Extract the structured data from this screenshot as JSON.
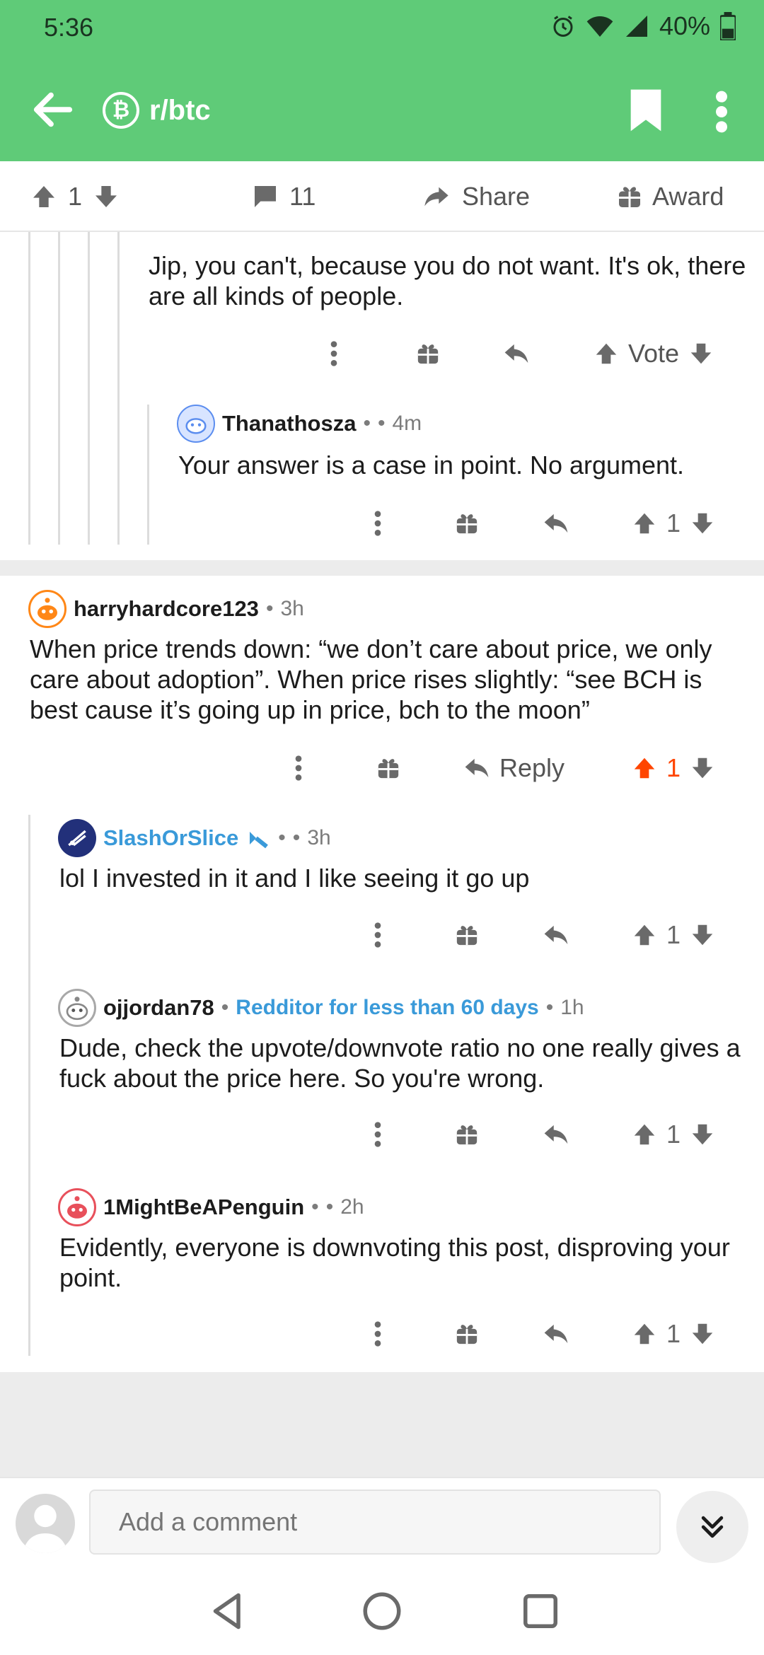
{
  "status_bar": {
    "time": "5:36",
    "battery": "40%"
  },
  "header": {
    "subreddit": "r/btc",
    "coin_symbol": "₿"
  },
  "post_bar": {
    "score": "1",
    "comments": "11",
    "share": "Share",
    "award": "Award"
  },
  "comments": [
    {
      "id": "c1",
      "text": "Jip, you can't, because you do not want. It's ok, there are all kinds of people.",
      "vote_label": "Vote"
    },
    {
      "id": "c2",
      "user": "Thanathosza",
      "time": "4m",
      "text": "Your answer is a case in point. No argument.",
      "score": "1"
    },
    {
      "id": "c3",
      "user": "harryhardcore123",
      "time": "3h",
      "text": "When price trends down: “we don’t care about price, we only care about adoption”. When price rises slightly: “see BCH is best cause it’s going up in price, bch to the moon”",
      "score": "1",
      "reply": "Reply"
    },
    {
      "id": "c4",
      "user": "SlashOrSlice",
      "time": "3h",
      "text": "lol I invested in it and I like seeing it go up",
      "score": "1"
    },
    {
      "id": "c5",
      "user": "ojjordan78",
      "flair": "Redditor for less than 60 days",
      "time": "1h",
      "text": "Dude, check the upvote/downvote ratio no one really gives a fuck about the price here. So you're wrong.",
      "score": "1"
    },
    {
      "id": "c6",
      "user": "1MightBeAPenguin",
      "time": "2h",
      "text": "Evidently, everyone is downvoting this post, disproving your point.",
      "score": "1"
    }
  ],
  "composer": {
    "placeholder": "Add a comment"
  },
  "colors": {
    "header": "#5fcb78",
    "upvote_active": "#ff4500",
    "link_blue": "#3a9ad9"
  }
}
